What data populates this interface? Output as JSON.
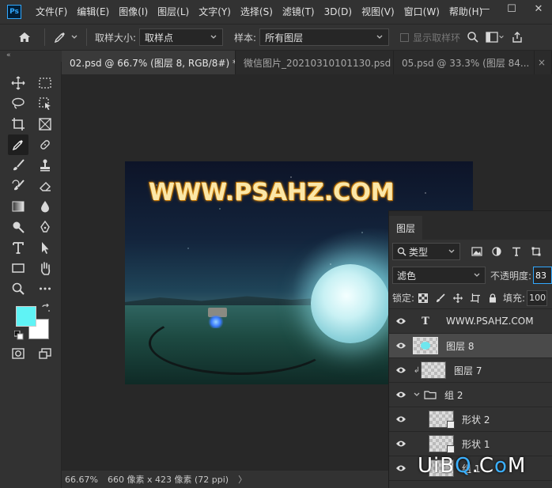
{
  "menu": {
    "logo": "Ps",
    "items": [
      "文件(F)",
      "编辑(E)",
      "图像(I)",
      "图层(L)",
      "文字(Y)",
      "选择(S)",
      "滤镜(T)",
      "3D(D)",
      "视图(V)",
      "窗口(W)",
      "帮助(H)"
    ],
    "window_controls": [
      "—",
      "☐",
      "✕"
    ]
  },
  "options": {
    "sample_size_label": "取样大小:",
    "sample_size_value": "取样点",
    "sample_label": "样本:",
    "sample_value": "所有图层",
    "show_ring_label": "显示取样环"
  },
  "toolbar": {
    "collapse": "«",
    "foreground_color": "#5ff3f5",
    "background_color": "#ffffff"
  },
  "tabs": [
    {
      "label": "02.psd @ 66.7% (图层 8, RGB/8#) *",
      "close": "×"
    },
    {
      "label": "微信图片_20210310101130.psd",
      "close": "×"
    },
    {
      "label": "05.psd @ 33.3% (图层 84...",
      "close": ""
    }
  ],
  "tabs_close_last": "×",
  "canvas": {
    "watermark_text": "WWW.PSAHZ.COM"
  },
  "status": {
    "zoom": "66.67%",
    "info": "660 像素 x 423 像素 (72 ppi)",
    "arrow": "〉"
  },
  "layers_panel": {
    "tab": "图层",
    "filter_kind": "类型",
    "blend_mode": "滤色",
    "opacity_label": "不透明度:",
    "opacity_value": "83",
    "lock_label": "锁定:",
    "fill_label": "填充:",
    "fill_value": "100",
    "layers": [
      {
        "name": "WWW.PSAHZ.COM",
        "kind": "text"
      },
      {
        "name": "图层 8",
        "kind": "pixel",
        "selected": true
      },
      {
        "name": "图层 7",
        "kind": "pixel",
        "clipped": true
      },
      {
        "name": "组 2",
        "kind": "group"
      },
      {
        "name": "形状 2",
        "kind": "shape"
      },
      {
        "name": "形状 1",
        "kind": "shape"
      },
      {
        "name": "组 1",
        "kind": "group"
      }
    ]
  },
  "site_watermark": {
    "part1": "UiB",
    "part2": "Q",
    "part3": ".C",
    "part4": "o",
    "part5": "M"
  }
}
